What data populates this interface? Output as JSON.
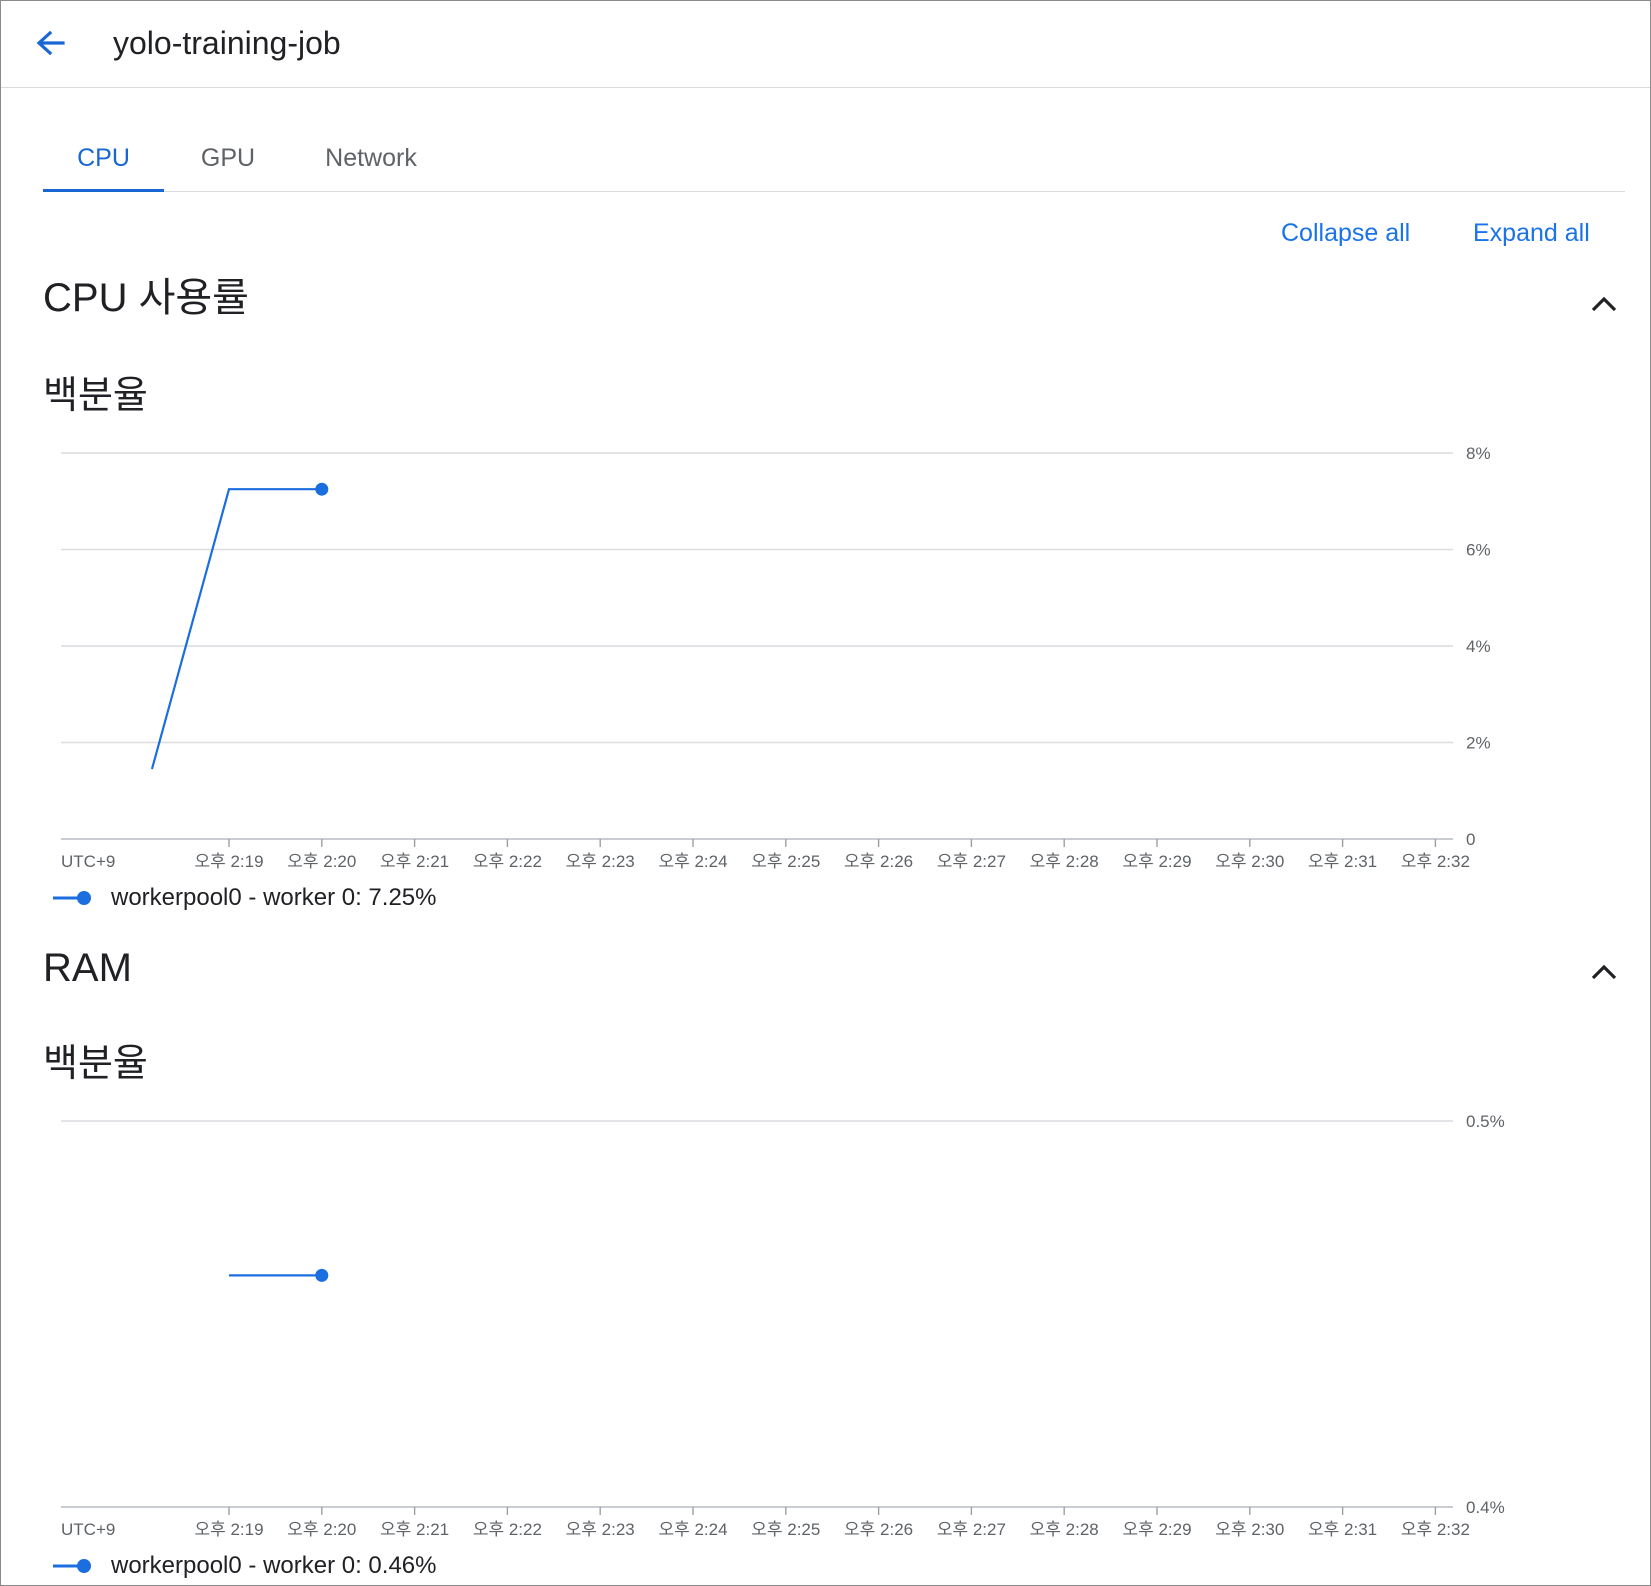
{
  "header": {
    "back_icon": "arrow-back-icon",
    "title": "yolo-training-job"
  },
  "tabs": [
    {
      "label": "CPU",
      "active": true
    },
    {
      "label": "GPU",
      "active": false
    },
    {
      "label": "Network",
      "active": false
    }
  ],
  "actions": {
    "collapse_all": "Collapse all",
    "expand_all": "Expand all"
  },
  "colors": {
    "accent": "#1967d2",
    "series": "#1a6ee0",
    "grid": "#dadce0"
  },
  "sections": [
    {
      "title": "CPU 사용률",
      "chevron_icon": "chevron-up-icon"
    },
    {
      "title": "RAM",
      "chevron_icon": "chevron-up-icon"
    }
  ],
  "chart_data": [
    {
      "type": "line",
      "subtitle": "백분율",
      "timezone_label": "UTC+9",
      "x_tick_labels": [
        "오후 2:19",
        "오후 2:20",
        "오후 2:21",
        "오후 2:22",
        "오후 2:23",
        "오후 2:24",
        "오후 2:25",
        "오후 2:26",
        "오후 2:27",
        "오후 2:28",
        "오후 2:29",
        "오후 2:30",
        "오후 2:31",
        "오후 2:32"
      ],
      "y_tick_labels": [
        "0",
        "2%",
        "4%",
        "6%",
        "8%"
      ],
      "y_ticks": [
        0,
        2,
        4,
        6,
        8
      ],
      "ylim": [
        0,
        8
      ],
      "y_axis_side": "right",
      "grid": true,
      "series": [
        {
          "name": "workerpool0 - worker 0",
          "legend_value": "7.25%",
          "points": [
            {
              "x": "오후 2:18",
              "y": 1.45
            },
            {
              "x": "오후 2:19",
              "y": 7.25
            },
            {
              "x": "오후 2:20",
              "y": 7.25
            }
          ]
        }
      ],
      "legend_text": "workerpool0 - worker 0:  7.25%"
    },
    {
      "type": "line",
      "subtitle": "백분율",
      "timezone_label": "UTC+9",
      "x_tick_labels": [
        "오후 2:19",
        "오후 2:20",
        "오후 2:21",
        "오후 2:22",
        "오후 2:23",
        "오후 2:24",
        "오후 2:25",
        "오후 2:26",
        "오후 2:27",
        "오후 2:28",
        "오후 2:29",
        "오후 2:30",
        "오후 2:31",
        "오후 2:32"
      ],
      "y_tick_labels": [
        "0.4%",
        "0.5%"
      ],
      "y_ticks": [
        0.4,
        0.5
      ],
      "ylim": [
        0.4,
        0.5
      ],
      "y_axis_side": "right",
      "grid": true,
      "series": [
        {
          "name": "workerpool0 - worker 0",
          "legend_value": "0.46%",
          "points": [
            {
              "x": "오후 2:19",
              "y": 0.46
            },
            {
              "x": "오후 2:20",
              "y": 0.46
            }
          ]
        }
      ],
      "legend_text": "workerpool0 - worker 0:  0.46%"
    }
  ]
}
